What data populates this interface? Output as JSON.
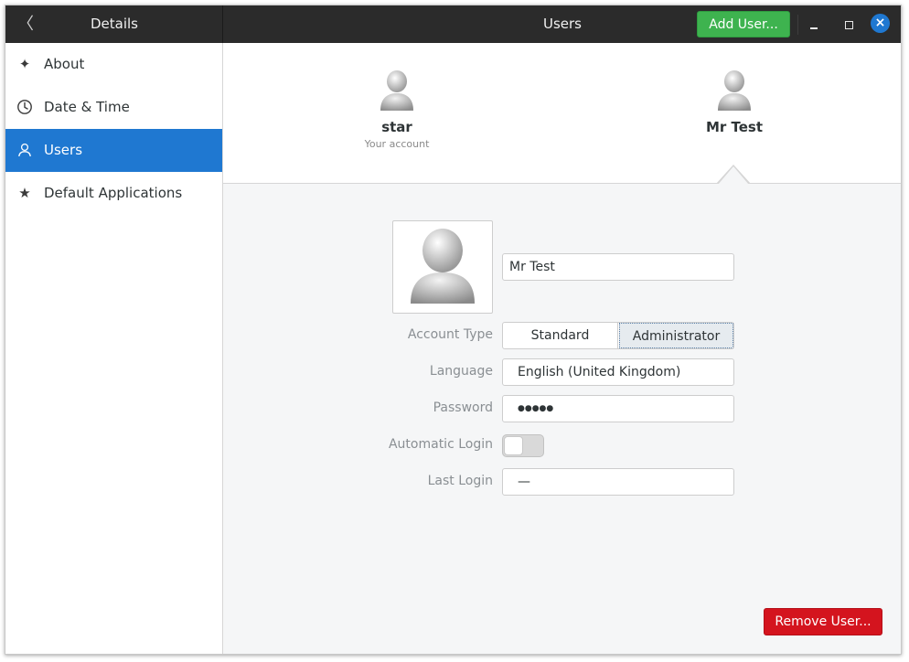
{
  "titlebar": {
    "left_title": "Details",
    "title": "Users",
    "add_user_label": "Add User...",
    "close_glyph": "×",
    "back_glyph": "〈"
  },
  "sidebar": {
    "items": [
      {
        "label": "About",
        "icon": "sparkle-icon",
        "glyph": "✦",
        "active": false
      },
      {
        "label": "Date & Time",
        "icon": "clock-icon",
        "glyph": "",
        "active": false
      },
      {
        "label": "Users",
        "icon": "user-icon",
        "glyph": "",
        "active": true
      },
      {
        "label": "Default Applications",
        "icon": "star-icon",
        "glyph": "★",
        "active": false
      }
    ]
  },
  "users": [
    {
      "name": "star",
      "subtitle": "Your account"
    },
    {
      "name": "Mr Test",
      "subtitle": ""
    }
  ],
  "detail": {
    "full_name": "Mr Test",
    "account_type": {
      "label": "Account Type",
      "options": [
        "Standard",
        "Administrator"
      ],
      "selected": "Administrator"
    },
    "language": {
      "label": "Language",
      "value": "English (United Kingdom)"
    },
    "password": {
      "label": "Password",
      "value": "●●●●●"
    },
    "automatic_login": {
      "label": "Automatic Login",
      "enabled": false
    },
    "last_login": {
      "label": "Last Login",
      "value": "—"
    },
    "remove_label": "Remove User..."
  },
  "colors": {
    "accent": "#1f78d1",
    "add_button": "#3eb34f",
    "remove_button": "#d4141e",
    "titlebar": "#2b2b2b"
  }
}
